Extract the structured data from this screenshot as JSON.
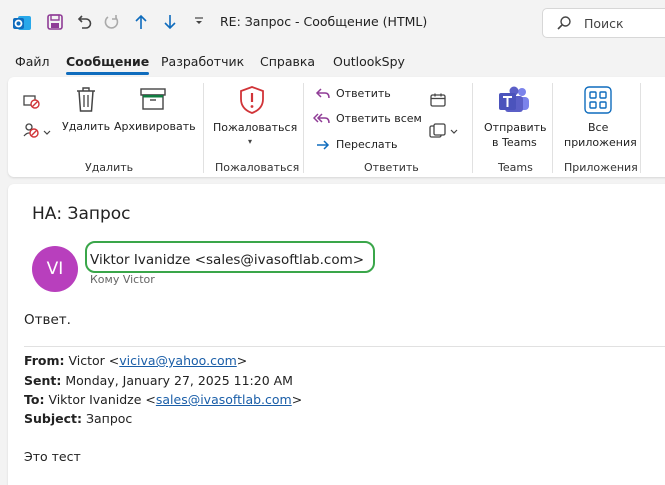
{
  "titlebar": {
    "title": "RE: Запрос  -  Сообщение (HTML)",
    "search_placeholder": "Поиск",
    "app_logo_letter": "O"
  },
  "tabs": [
    {
      "label": "Файл"
    },
    {
      "label": "Сообщение",
      "active": true
    },
    {
      "label": "Разработчик"
    },
    {
      "label": "Справка"
    },
    {
      "label": "OutlookSpy"
    }
  ],
  "ribbon": {
    "delete_label": "Удалить",
    "archive_label": "Архивировать",
    "group_delete": "Удалить",
    "report_label": "Пожаловаться",
    "group_report": "Пожаловаться",
    "reply_label": "Ответить",
    "reply_all_label": "Ответить всем",
    "forward_label": "Переслать",
    "group_respond": "Ответить",
    "teams_label_1": "Отправить",
    "teams_label_2": "в Teams",
    "group_teams": "Teams",
    "apps_label_1": "Все",
    "apps_label_2": "приложения",
    "group_apps": "Приложения"
  },
  "message": {
    "subject": "НА: Запрос",
    "avatar_initials": "VI",
    "sender": "Viktor Ivanidze <sales@ivasoftlab.com>",
    "to_line": "Кому    Victor",
    "reply_text": "Ответ.",
    "from_label": "From:",
    "from_name": "Victor <",
    "from_email": "viciva@yahoo.com",
    "from_end": ">",
    "sent_label": "Sent:",
    "sent_value": "Monday, January 27, 2025 11:20 AM",
    "to_label": "To:",
    "to_name": "Viktor Ivanidze <",
    "to_email": "sales@ivasoftlab.com",
    "to_end": ">",
    "subject_label": "Subject:",
    "subject_value": "Запрос",
    "body": "Это тест"
  },
  "colors": {
    "accent": "#0f6cbd",
    "avatar": "#b83fbd",
    "highlight": "#3aa64a",
    "report_red": "#d13438",
    "teams_purple": "#5b5fc7"
  }
}
